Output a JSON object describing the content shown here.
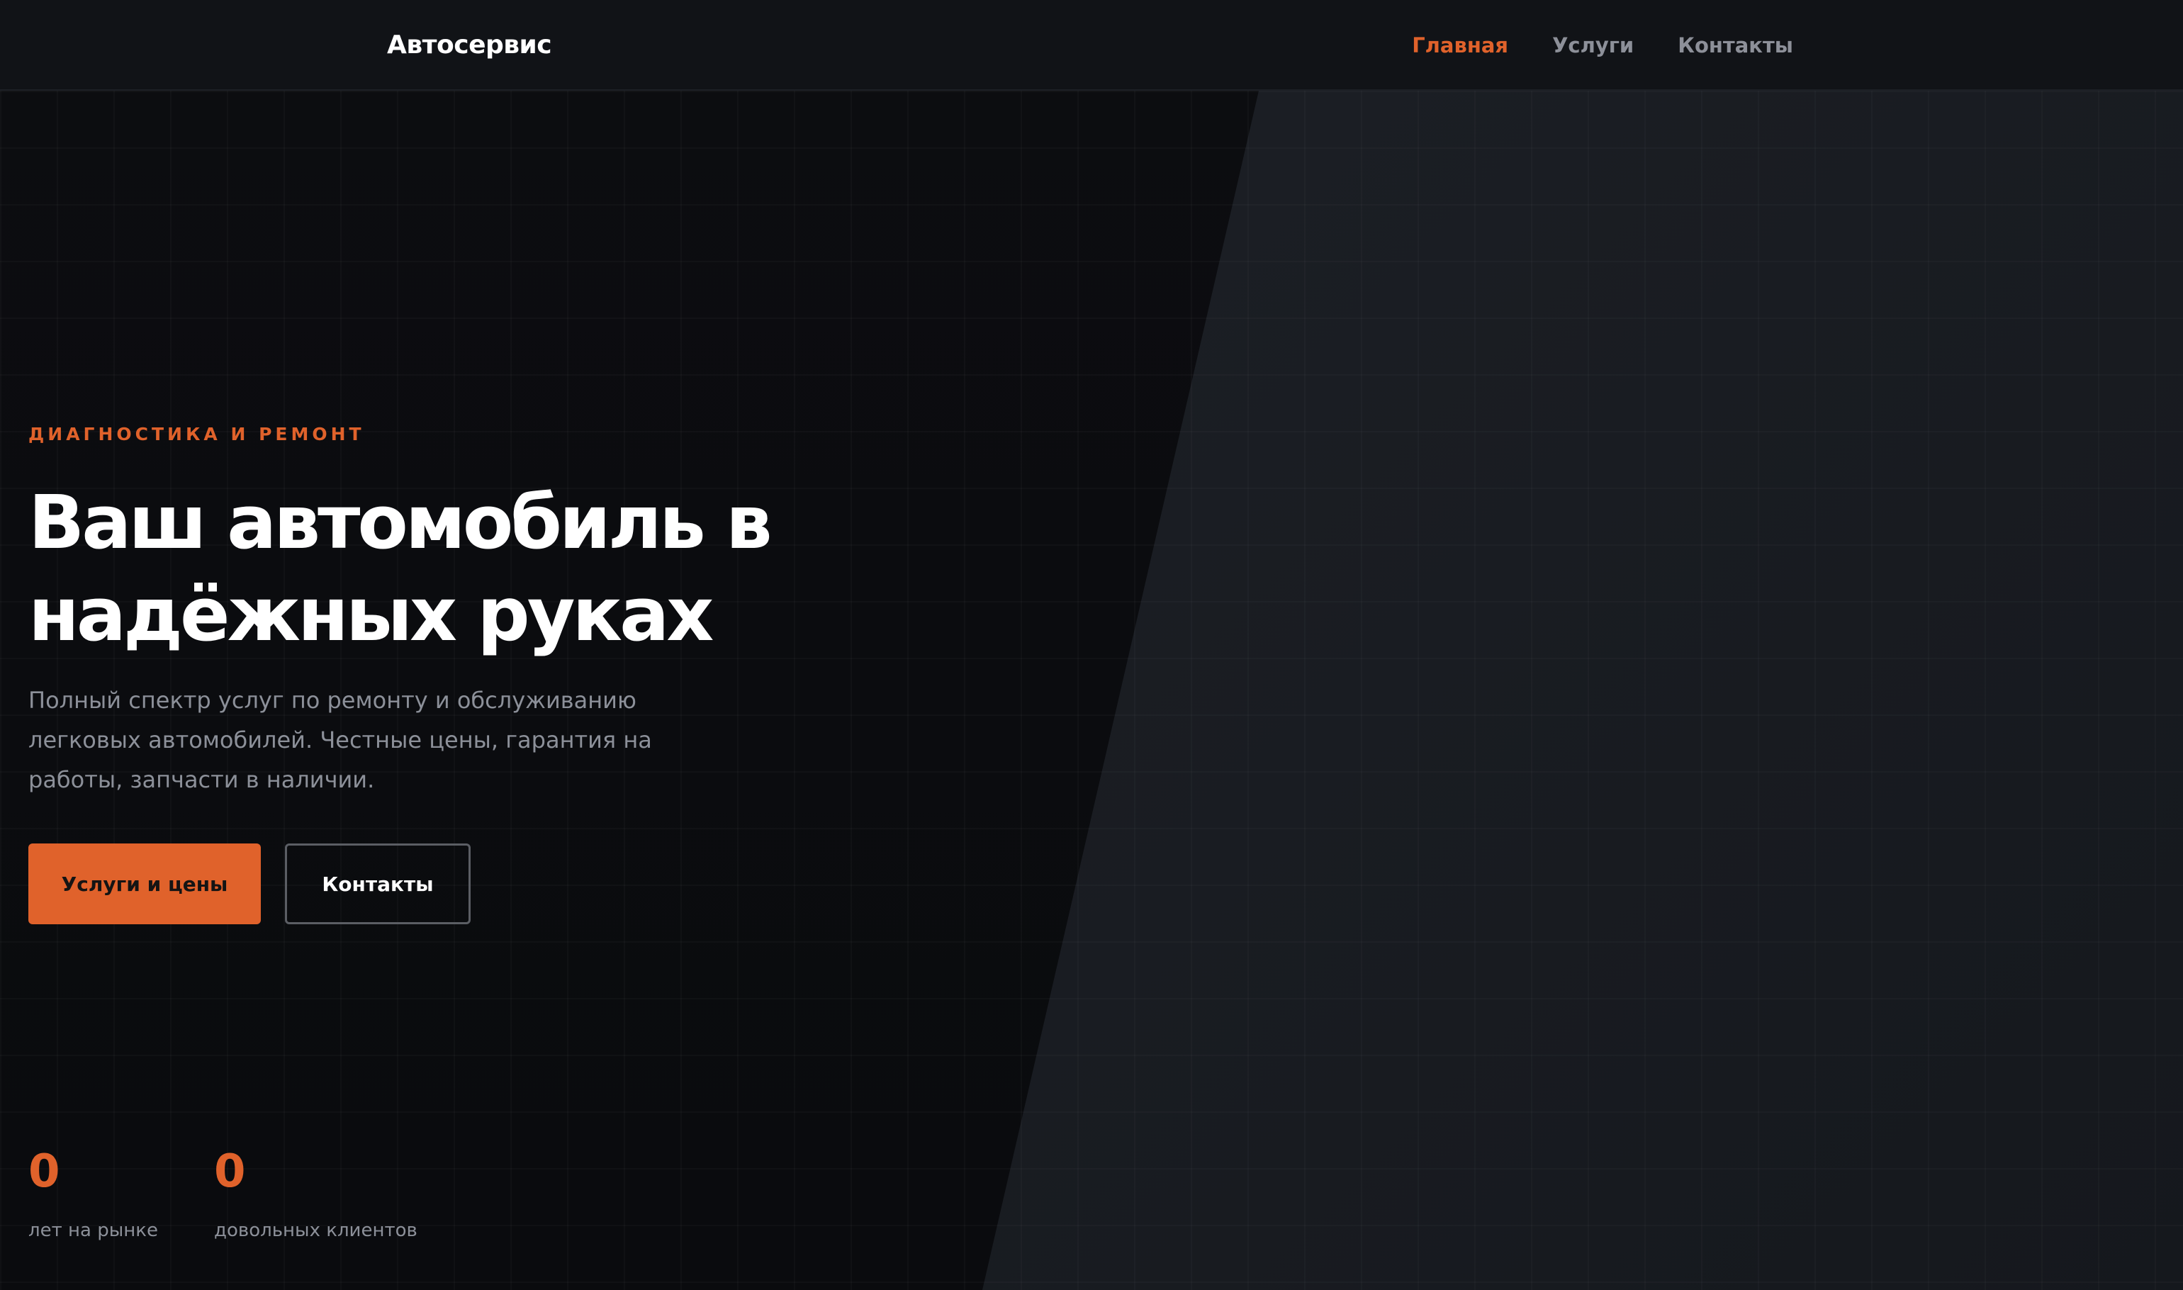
{
  "header": {
    "logo": "Автосервис",
    "nav": [
      {
        "label": "Главная",
        "active": true
      },
      {
        "label": "Услуги",
        "active": false
      },
      {
        "label": "Контакты",
        "active": false
      }
    ]
  },
  "hero": {
    "kicker": "ДИАГНОСТИКА И РЕМОНТ",
    "title_line1": "Ваш автомобиль в",
    "title_line2": "надёжных руках",
    "description": "Полный спектр услуг по ремонту и обслуживанию легковых автомобилей. Честные цены, гарантия на работы, запчасти в наличии.",
    "primary_button": "Услуги и цены",
    "secondary_button": "Контакты"
  },
  "stats": [
    {
      "value": "0",
      "label": "лет на рынке"
    },
    {
      "value": "0",
      "label": "довольных клиентов"
    }
  ],
  "colors": {
    "accent": "#e0622b",
    "background": "#0b0c0f",
    "header_background": "#111317",
    "panel": "#1b1e24",
    "text_primary": "#ffffff",
    "text_muted": "#8c9099"
  }
}
